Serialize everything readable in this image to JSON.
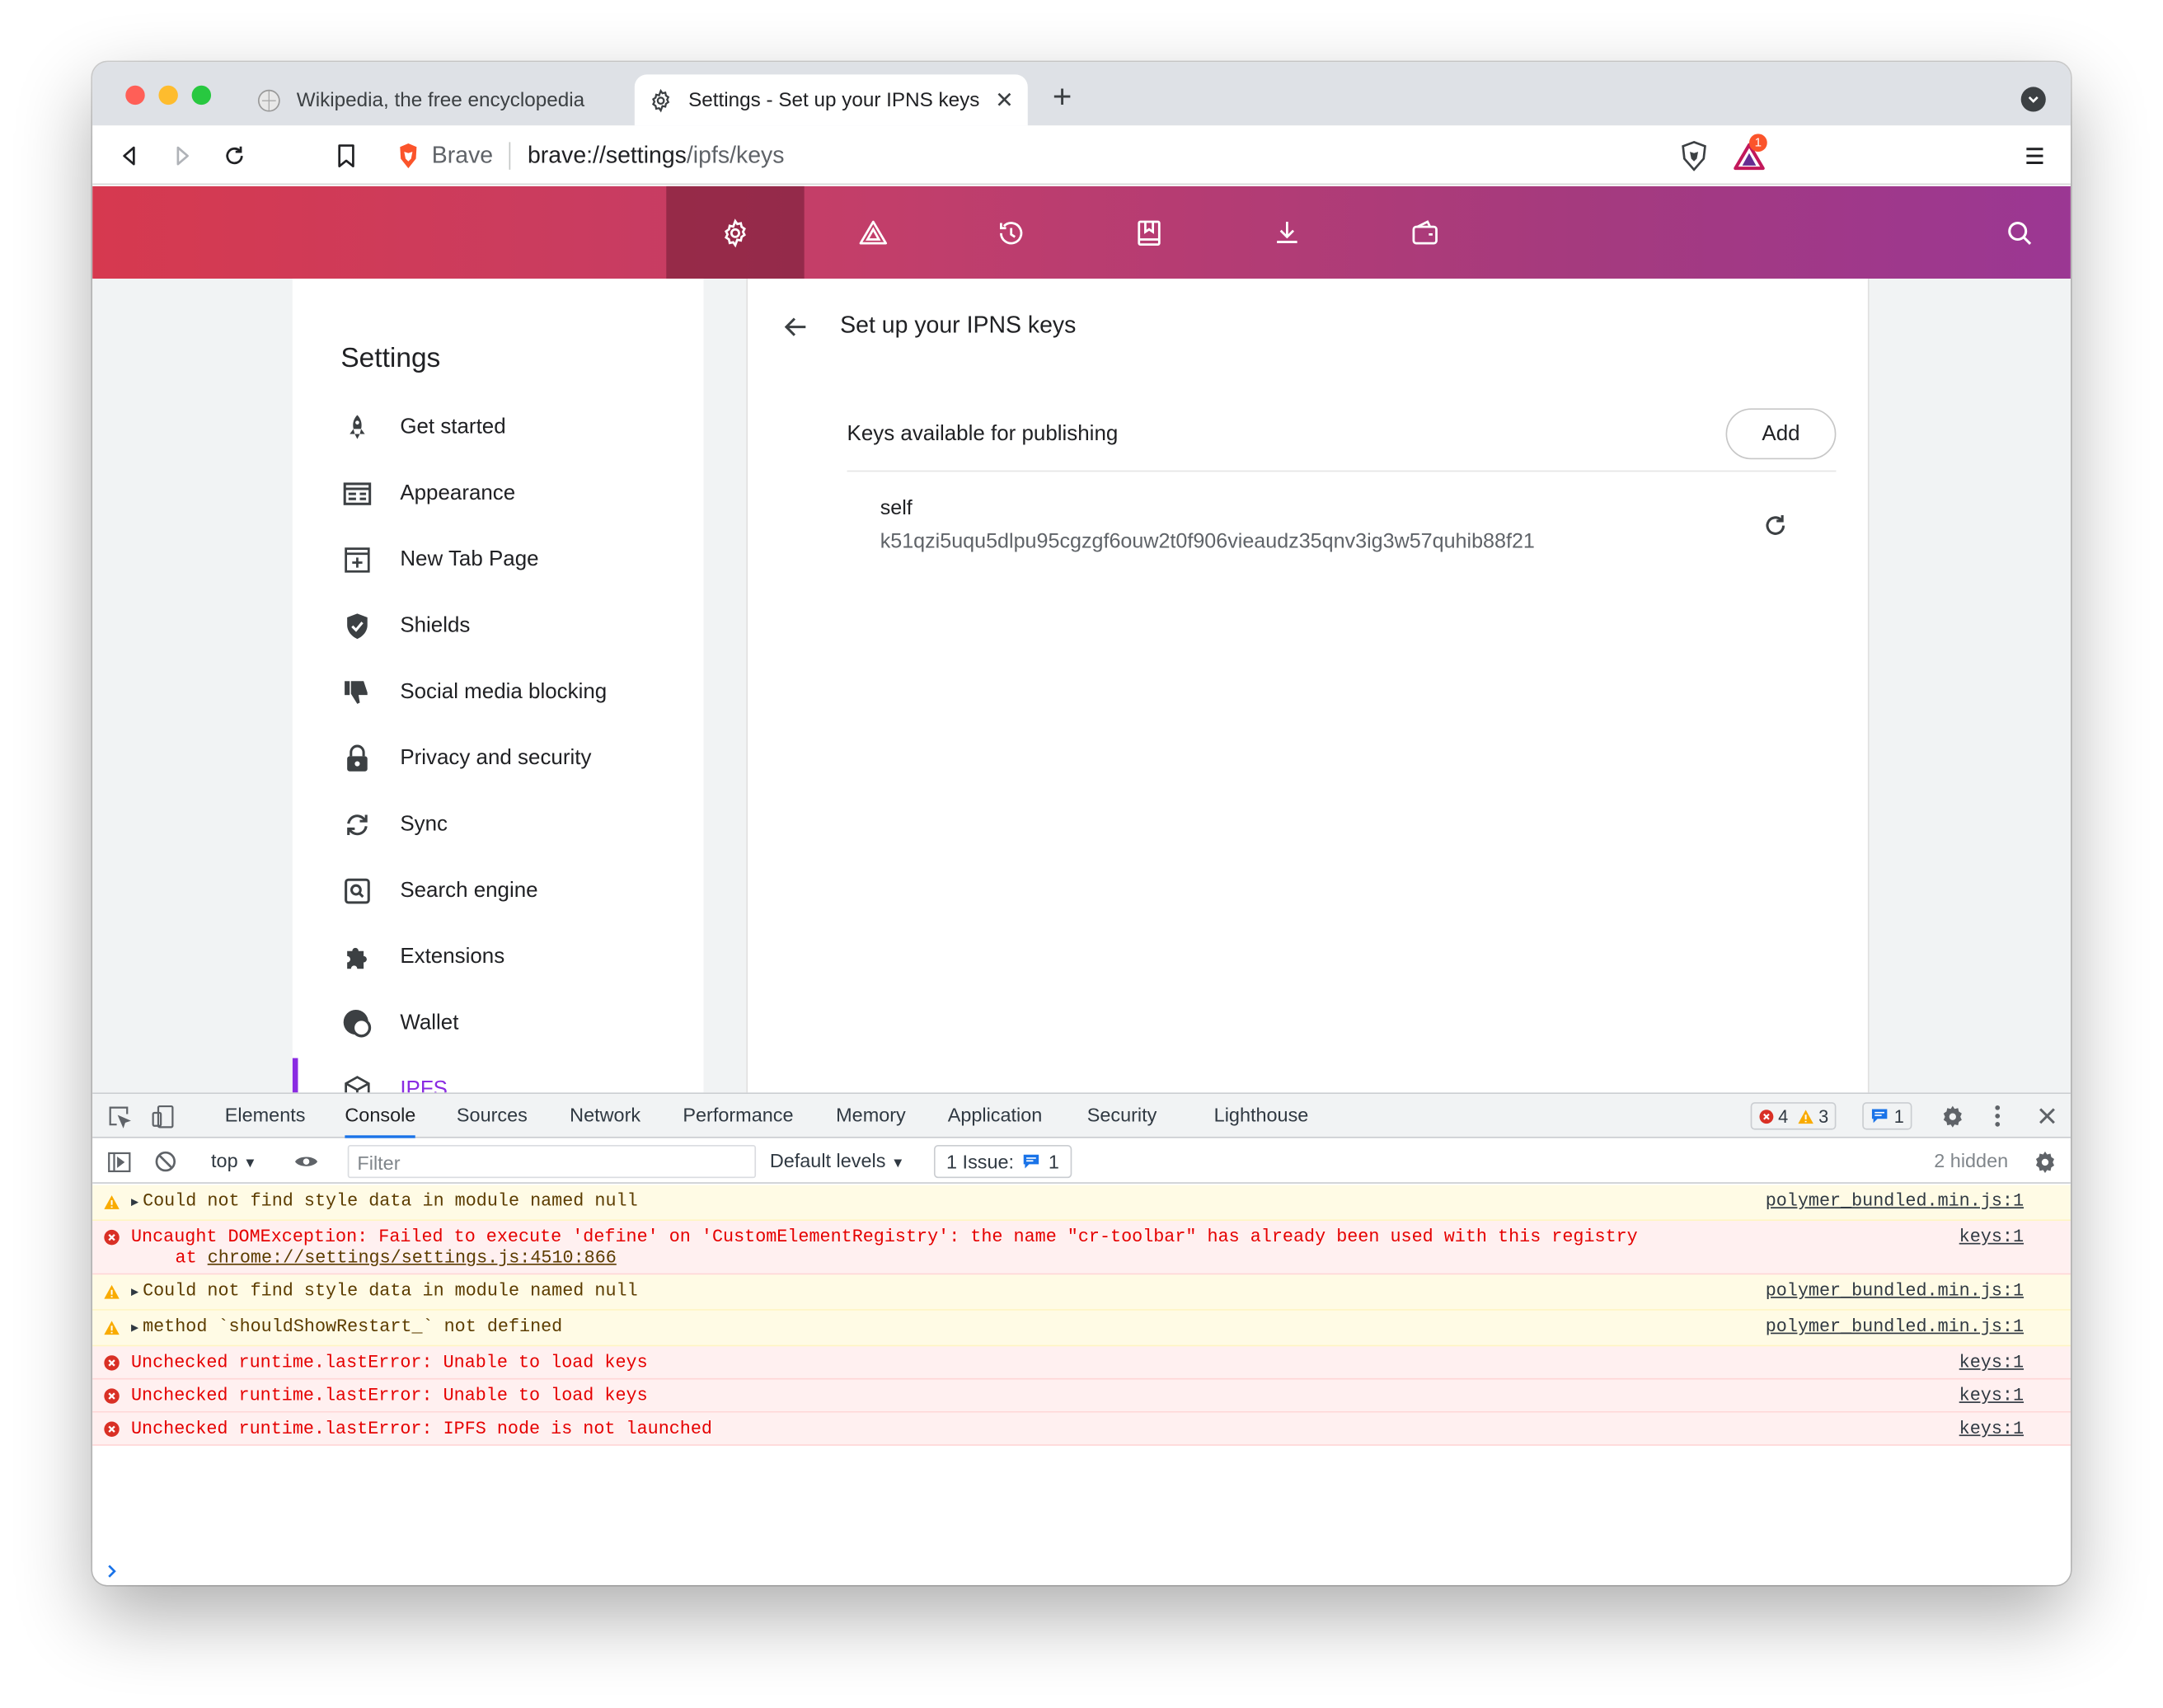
{
  "browser": {
    "tabs": [
      {
        "title": "Wikipedia, the free encyclopedia",
        "active": false
      },
      {
        "title": "Settings - Set up your IPNS keys",
        "active": true
      }
    ],
    "omnibox": {
      "brand": "Brave",
      "url_host": "brave://settings",
      "url_path": "/ipfs/keys"
    },
    "rewards_badge": "1"
  },
  "colors": {
    "accent": "#8a2be2",
    "error": "#e50000",
    "warning_bg": "#fffbe5",
    "error_bg": "#fff0f0",
    "link_blue": "#1a73e8"
  },
  "settings": {
    "title": "Settings",
    "menu": [
      {
        "label": "Get started",
        "icon": "rocket-icon"
      },
      {
        "label": "Appearance",
        "icon": "appearance-icon"
      },
      {
        "label": "New Tab Page",
        "icon": "new-tab-icon"
      },
      {
        "label": "Shields",
        "icon": "shield-icon"
      },
      {
        "label": "Social media blocking",
        "icon": "thumbs-down-icon"
      },
      {
        "label": "Privacy and security",
        "icon": "lock-icon"
      },
      {
        "label": "Sync",
        "icon": "sync-icon"
      },
      {
        "label": "Search engine",
        "icon": "search-engine-icon"
      },
      {
        "label": "Extensions",
        "icon": "puzzle-icon"
      },
      {
        "label": "Wallet",
        "icon": "wallet-icon"
      },
      {
        "label": "IPFS",
        "icon": "cube-icon",
        "selected": true
      }
    ],
    "page": {
      "title": "Set up your IPNS keys",
      "keys_label": "Keys available for publishing",
      "add_label": "Add",
      "keys": [
        {
          "name": "self",
          "id": "k51qzi5uqu5dlpu95cgzgf6ouw2t0f906vieaudz35qnv3ig3w57quhib88f21"
        }
      ]
    }
  },
  "devtools": {
    "tabs": [
      "Elements",
      "Console",
      "Sources",
      "Network",
      "Performance",
      "Memory",
      "Application",
      "Security",
      "Lighthouse"
    ],
    "active_tab": "Console",
    "error_count": "4",
    "warning_count": "3",
    "message_count": "1",
    "context": "top",
    "filter_placeholder": "Filter",
    "levels": "Default levels",
    "issues_label": "1 Issue:",
    "issues_count": "1",
    "hidden": "2 hidden",
    "messages": [
      {
        "level": "warn",
        "expand": true,
        "text": "Could not find style data in module named null",
        "source": "polymer_bundled.min.js:1"
      },
      {
        "level": "err",
        "expand": false,
        "text": "Uncaught DOMException: Failed to execute 'define' on 'CustomElementRegistry': the name \"cr-toolbar\" has already been used with this registry",
        "sub_prefix": "at ",
        "sub_link": "chrome://settings/settings.js:4510:866",
        "source": "keys:1"
      },
      {
        "level": "warn",
        "expand": true,
        "text": "Could not find style data in module named null",
        "source": "polymer_bundled.min.js:1"
      },
      {
        "level": "warn",
        "expand": true,
        "text": "method `shouldShowRestart_` not defined",
        "source": "polymer_bundled.min.js:1"
      },
      {
        "level": "err",
        "expand": false,
        "text": "Unchecked runtime.lastError: Unable to load keys",
        "source": "keys:1"
      },
      {
        "level": "err",
        "expand": false,
        "text": "Unchecked runtime.lastError: Unable to load keys",
        "source": "keys:1"
      },
      {
        "level": "err",
        "expand": false,
        "text": "Unchecked runtime.lastError: IPFS node is not launched",
        "source": "keys:1"
      }
    ]
  }
}
